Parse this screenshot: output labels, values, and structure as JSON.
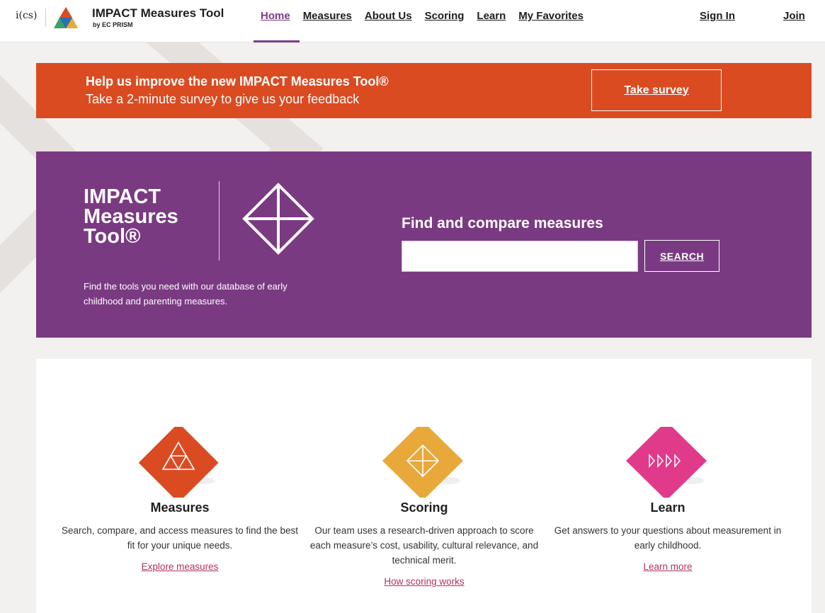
{
  "header": {
    "org_logo_text": "i(cs)",
    "title": "IMPACT Measures Tool",
    "subtitle": "by EC PRISM",
    "nav": [
      {
        "label": "Home",
        "active": true
      },
      {
        "label": "Measures"
      },
      {
        "label": "About Us"
      },
      {
        "label": "Scoring"
      },
      {
        "label": "Learn"
      },
      {
        "label": "My Favorites"
      }
    ],
    "sign_in": "Sign In",
    "join": "Join"
  },
  "survey": {
    "title": "Help us improve the new IMPACT Measures Tool®",
    "subtitle": "Take a 2-minute survey to give us your feedback",
    "button": "Take survey",
    "color": "#db4b22"
  },
  "hero": {
    "title": "IMPACT Measures Tool®",
    "description": "Find the tools you need with our database of early childhood and parenting measures.",
    "search_label": "Find and compare measures",
    "search_value": "",
    "search_button": "SEARCH",
    "color": "#7a3a82"
  },
  "features": [
    {
      "title": "Measures",
      "description": "Search, compare, and access measures to find the best fit for your unique needs.",
      "link": "Explore measures",
      "icon": "triangle-grid-diamond-icon",
      "color": "#db4b22"
    },
    {
      "title": "Scoring",
      "description": "Our team uses a research-driven approach to score each measure’s cost, usability, cultural relevance, and technical merit.",
      "link": "How scoring works",
      "icon": "crosshair-diamond-icon",
      "color": "#e8a93a"
    },
    {
      "title": "Learn",
      "description": "Get answers to your questions about measurement in early childhood.",
      "link": "Learn more",
      "icon": "play-arrows-diamond-icon",
      "color": "#e13a8a"
    }
  ],
  "colors": {
    "link_pink": "#b4325a",
    "nav_active": "#7a3a8a"
  }
}
